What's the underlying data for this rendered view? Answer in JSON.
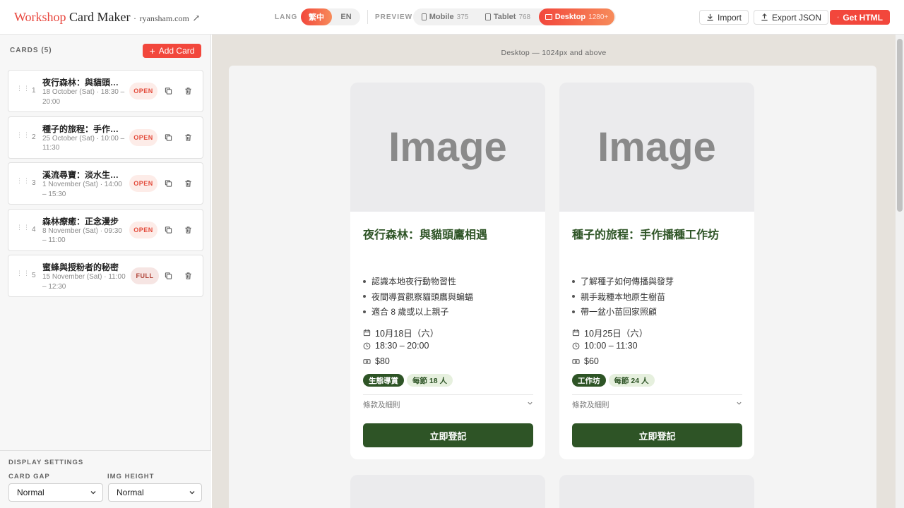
{
  "brand": {
    "word1": "Workshop",
    "word2": "Card Maker",
    "dot": "·",
    "site": "ryansham.com",
    "arrow": "↗"
  },
  "lang": {
    "label": "LANG",
    "options": [
      "繁中",
      "EN"
    ],
    "selected": "繁中"
  },
  "preview_modes": {
    "label": "PREVIEW",
    "options": [
      {
        "name": "Mobile",
        "size": "375"
      },
      {
        "name": "Tablet",
        "size": "768"
      },
      {
        "name": "Desktop",
        "size": "1280+"
      }
    ],
    "selected": "Desktop"
  },
  "toolbar": {
    "import": "Import",
    "export": "Export JSON",
    "get_html": "Get HTML"
  },
  "sidebar": {
    "title": "CARDS (5)",
    "add_label": "Add Card",
    "cards": [
      {
        "num": "1",
        "title": "夜行森林：與貓頭鷹相遇",
        "sub": "18 October (Sat) · 18:30 – 20:00",
        "status": "OPEN"
      },
      {
        "num": "2",
        "title": "種子的旅程：手作播種工作坊",
        "sub": "25 October (Sat) · 10:00 – 11:30",
        "status": "OPEN"
      },
      {
        "num": "3",
        "title": "溪流尋寶：淡水生態探索",
        "sub": "1 November (Sat) · 14:00 – 15:30",
        "status": "OPEN"
      },
      {
        "num": "4",
        "title": "森林療癒：正念漫步",
        "sub": "8 November (Sat) · 09:30 – 11:00",
        "status": "OPEN"
      },
      {
        "num": "5",
        "title": "蜜蜂與授粉者的秘密",
        "sub": "15 November (Sat) · 11:00 – 12:30",
        "status": "FULL"
      }
    ],
    "settings": {
      "title": "DISPLAY SETTINGS",
      "card_gap_label": "CARD GAP",
      "card_gap_value": "Normal",
      "img_height_label": "IMG HEIGHT",
      "img_height_value": "Normal"
    }
  },
  "preview": {
    "label": "Desktop — 1024px and above",
    "cards": [
      {
        "image_text": "Image",
        "title": "夜行森林：與貓頭鷹相遇",
        "bullets": [
          "認識本地夜行動物習性",
          "夜間導賞觀察貓頭鷹與蝙蝠",
          "適合 8 歲或以上親子"
        ],
        "date": "10月18日（六）",
        "time": "18:30 – 20:00",
        "price": "$80",
        "tag_primary": "生態導賞",
        "tag_secondary": "每節 18 人",
        "terms": "條款及細則",
        "button": "立即登記"
      },
      {
        "image_text": "Image",
        "title": "種子的旅程：手作播種工作坊",
        "bullets": [
          "了解種子如何傳播與發芽",
          "親手栽種本地原生樹苗",
          "帶一盆小苗回家照顧"
        ],
        "date": "10月25日（六）",
        "time": "10:00 – 11:30",
        "price": "$60",
        "tag_primary": "工作坊",
        "tag_secondary": "每節 24 人",
        "terms": "條款及細則",
        "button": "立即登記"
      }
    ]
  },
  "colors": {
    "accent": "#f2473c",
    "green": "#2e5426",
    "preview_bg": "#e6e2dc"
  }
}
